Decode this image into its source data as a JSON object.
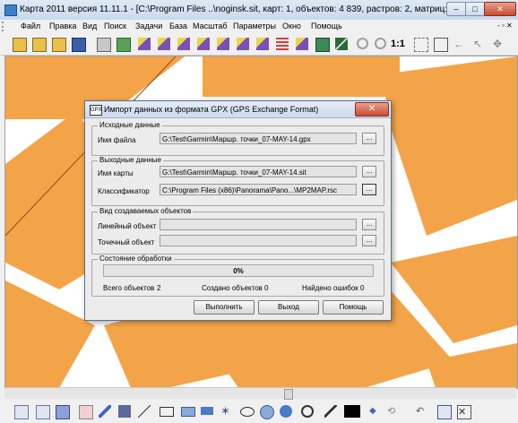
{
  "window": {
    "title": "Карта 2011 версия 11.11.1 - [C:\\Program Files ..\\noginsk.sit, карт: 1, объектов: 4 839, растров: 2, матриц: 1]",
    "min": "–",
    "max": "□",
    "close": "✕"
  },
  "menu": {
    "items": [
      "Файл",
      "Правка",
      "Вид",
      "Поиск",
      "Задачи",
      "База",
      "Масштаб",
      "Параметры",
      "Окно",
      "Помощь"
    ],
    "right": "- ▫ ✕"
  },
  "toolbar": {
    "scale_label": "1:1"
  },
  "map": {
    "colors": {
      "background": "#ffffff",
      "fill": "#f4a448",
      "line": "#8a4a1a"
    }
  },
  "dialog": {
    "title": "Импорт данных из формата GPX (GPS Exchange Format)",
    "icon_text": "GPX",
    "close": "✕",
    "source": {
      "group_label": "Исходные данные",
      "file_label": "Имя файла",
      "file_value": "G:\\Test\\Garmin\\Маршр. точки_07-MAY-14.gpx",
      "browse": "..."
    },
    "output": {
      "group_label": "Выходные данные",
      "map_label": "Имя карты",
      "map_value": "G:\\Test\\Garmin\\Маршр. точки_07-MAY-14.sit",
      "classifier_label": "Классификатор",
      "classifier_value": "C:\\Program Files (x86)\\Panorama\\Pano...\\MP2MAP.rsc",
      "browse": "..."
    },
    "objects": {
      "group_label": "Вид создаваемых объектов",
      "line_label": "Линейный объект",
      "point_label": "Точечный объект",
      "line_value": "",
      "point_value": "",
      "browse": "..."
    },
    "status": {
      "group_label": "Состояние обработки",
      "progress_text": "0%",
      "progress_value": 0,
      "total_label": "Всего объектов",
      "total_value": "2",
      "created_label": "Создано объектов",
      "created_value": "0",
      "errors_label": "Найдено ошибок",
      "errors_value": "0"
    },
    "buttons": {
      "run": "Выполнить",
      "exit": "Выход",
      "help": "Помощь"
    }
  }
}
